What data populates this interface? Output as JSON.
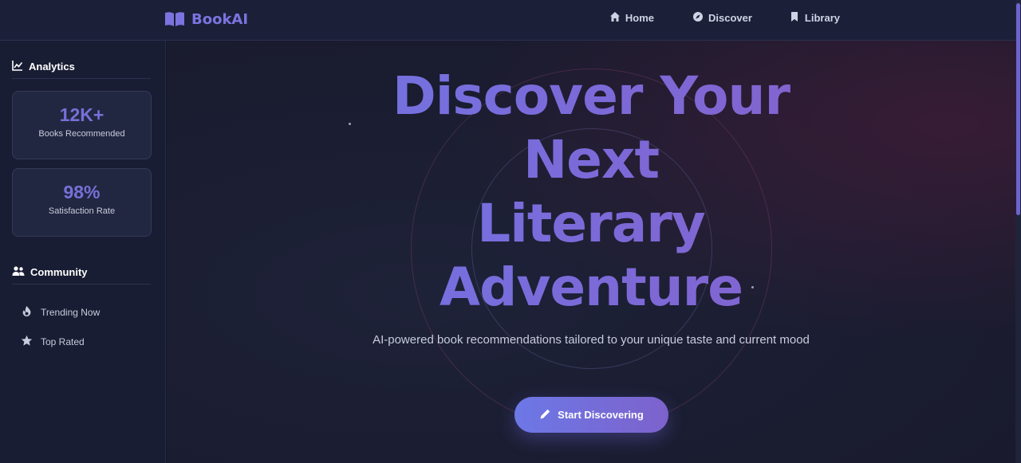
{
  "brand": {
    "name": "BookAI",
    "icon": "open-book-icon",
    "color": "#7b74e0"
  },
  "nav": {
    "items": [
      {
        "label": "Home",
        "icon": "home-icon"
      },
      {
        "label": "Discover",
        "icon": "compass-icon"
      },
      {
        "label": "Library",
        "icon": "bookmark-icon"
      }
    ]
  },
  "sidebar": {
    "analytics": {
      "heading": "Analytics",
      "icon": "chart-line-icon",
      "stats": [
        {
          "value": "12K+",
          "label": "Books Recommended"
        },
        {
          "value": "98%",
          "label": "Satisfaction Rate"
        }
      ]
    },
    "community": {
      "heading": "Community",
      "icon": "users-icon",
      "links": [
        {
          "label": "Trending Now",
          "icon": "fire-icon"
        },
        {
          "label": "Top Rated",
          "icon": "star-icon"
        }
      ]
    }
  },
  "hero": {
    "title_lines": [
      "Discover Your",
      "Next",
      "Literary",
      "Adventure"
    ],
    "subtitle": "AI-powered book recommendations tailored to your unique taste and current mood",
    "cta_label": "Start Discovering",
    "cta_icon": "pencil-icon"
  },
  "colors": {
    "accent": "#7670d8",
    "gradient_start": "#6f78e8",
    "gradient_end": "#8a5ec7",
    "background": "#16182a"
  }
}
